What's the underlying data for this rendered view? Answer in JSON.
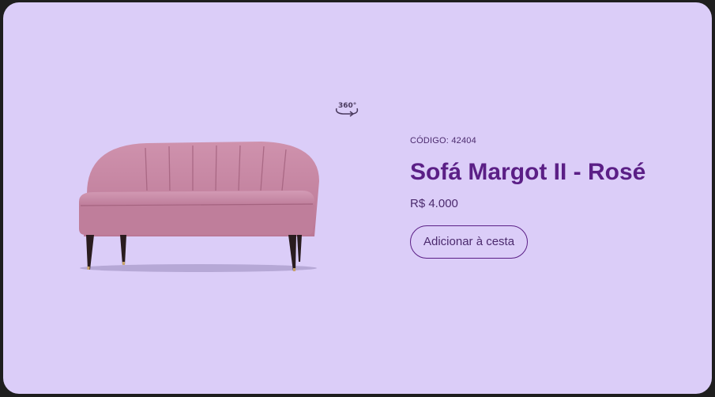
{
  "product": {
    "code_label": "CÓDIGO: 42404",
    "name": "Sofá Margot II - Rosé",
    "price": "R$ 4.000",
    "add_to_cart_label": "Adicionar à cesta",
    "view_360_label": "360°",
    "image": "pink-sofa"
  },
  "colors": {
    "card_background": "#dbcdf8",
    "title": "#5b1f86",
    "text": "#4b2a6d",
    "sofa": "#c88aa6"
  }
}
